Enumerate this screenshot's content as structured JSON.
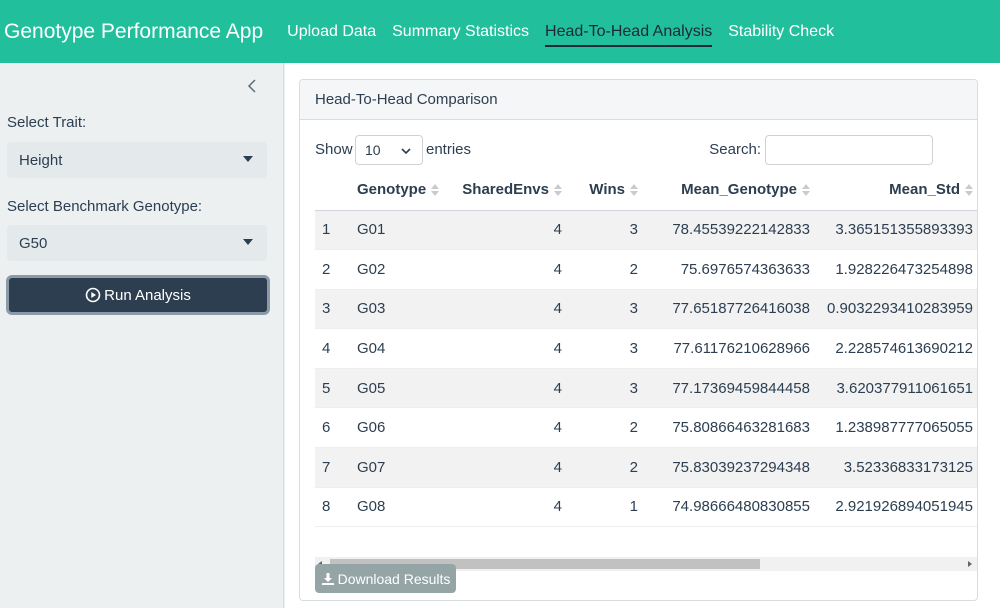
{
  "navbar": {
    "brand": "Genotype Performance App",
    "tabs": [
      {
        "label": "Upload Data",
        "active": false
      },
      {
        "label": "Summary Statistics",
        "active": false
      },
      {
        "label": "Head-To-Head Analysis",
        "active": true
      },
      {
        "label": "Stability Check",
        "active": false
      }
    ]
  },
  "sidebar": {
    "trait_label": "Select Trait:",
    "trait_value": "Height",
    "benchmark_label": "Select Benchmark Genotype:",
    "benchmark_value": "G50",
    "run_label": "Run Analysis"
  },
  "panel": {
    "title": "Head-To-Head Comparison",
    "show_label": "Show",
    "entries_value": "10",
    "entries_label": "entries",
    "search_label": "Search:",
    "search_value": "",
    "download_label": "Download Results"
  },
  "table": {
    "columns": [
      "",
      "Genotype",
      "SharedEnvs",
      "Wins",
      "Mean_Genotype",
      "Mean_Std"
    ],
    "rows": [
      [
        "1",
        "G01",
        "4",
        "3",
        "78.45539222142833",
        "3.365151355893393"
      ],
      [
        "2",
        "G02",
        "4",
        "2",
        "75.6976574363633",
        "1.928226473254898"
      ],
      [
        "3",
        "G03",
        "4",
        "3",
        "77.65187726416038",
        "0.9032293410283959"
      ],
      [
        "4",
        "G04",
        "4",
        "3",
        "77.61176210628966",
        "2.228574613690212"
      ],
      [
        "5",
        "G05",
        "4",
        "3",
        "77.17369459844458",
        "3.620377911061651"
      ],
      [
        "6",
        "G06",
        "4",
        "2",
        "75.80866463281683",
        "1.238987777065055"
      ],
      [
        "7",
        "G07",
        "4",
        "2",
        "75.83039237294348",
        "3.52336833173125"
      ],
      [
        "8",
        "G08",
        "4",
        "1",
        "74.98666480830855",
        "2.921926894051945"
      ]
    ]
  },
  "colors": {
    "navbar": "#22bf9c",
    "primary_button": "#2c3e50",
    "secondary_button": "#95a5a6"
  }
}
